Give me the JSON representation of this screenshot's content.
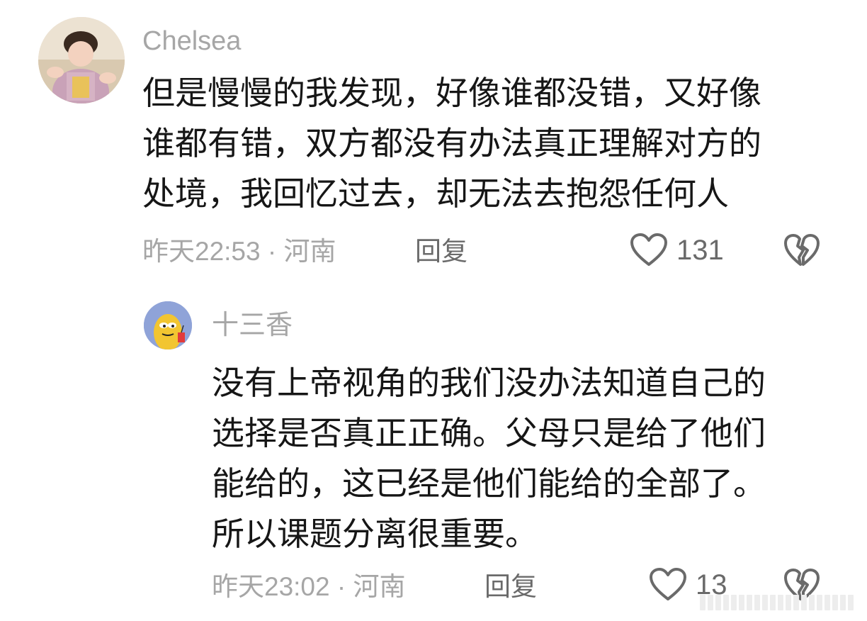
{
  "comments": [
    {
      "username": "Chelsea",
      "lines": [
        "但是慢慢的我发现，好像谁都没错，又好像",
        "谁都有错，双方都没有办法真正理解对方的",
        "处境，我回忆过去，却无法去抱怨任何人"
      ],
      "meta": "昨天22:53 · 河南",
      "reply_label": "回复",
      "likes": "131",
      "avatar_icon": "child-photo-avatar"
    },
    {
      "username": "十三香",
      "lines": [
        "没有上帝视角的我们没办法知道自己的",
        "选择是否真正正确。父母只是给了他们",
        "能给的，这已经是他们能给的全部了。",
        "所以课题分离很重要。"
      ],
      "meta": "昨天23:02 · 河南",
      "reply_label": "回复",
      "likes": "13",
      "avatar_icon": "cartoon-fish-avatar"
    }
  ],
  "colors": {
    "text": "#161616",
    "meta": "#a6a6a6",
    "action": "#6a6a6a",
    "background": "#ffffff"
  }
}
